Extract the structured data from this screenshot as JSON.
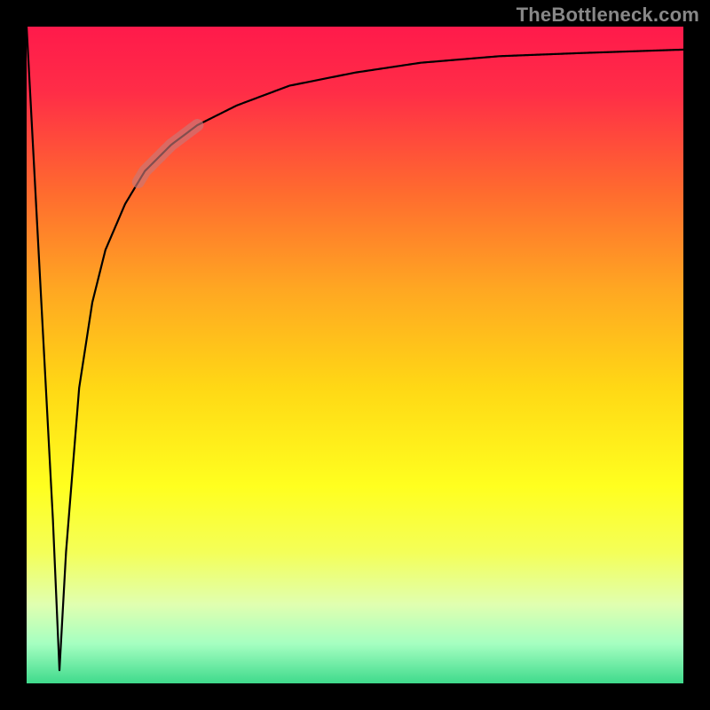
{
  "watermark": "TheBottleneck.com",
  "colors": {
    "frame": "#000000",
    "curve": "#000000",
    "highlight": "rgba(200,120,120,0.65)",
    "gradient_stops": [
      {
        "offset": 0.0,
        "color": "#ff1a4b"
      },
      {
        "offset": 0.1,
        "color": "#ff2d47"
      },
      {
        "offset": 0.25,
        "color": "#ff6a2f"
      },
      {
        "offset": 0.4,
        "color": "#ffa722"
      },
      {
        "offset": 0.55,
        "color": "#ffd815"
      },
      {
        "offset": 0.7,
        "color": "#ffff1f"
      },
      {
        "offset": 0.8,
        "color": "#f4ff58"
      },
      {
        "offset": 0.88,
        "color": "#e0ffb0"
      },
      {
        "offset": 0.94,
        "color": "#a5ffc1"
      },
      {
        "offset": 1.0,
        "color": "#3fda8c"
      }
    ]
  },
  "chart_data": {
    "type": "line",
    "title": "",
    "xlabel": "",
    "ylabel": "",
    "xlim": [
      0,
      100
    ],
    "ylim": [
      0,
      100
    ],
    "series": [
      {
        "name": "bottleneck-curve",
        "x": [
          0,
          4,
          5,
          6,
          8,
          10,
          12,
          15,
          18,
          22,
          26,
          32,
          40,
          50,
          60,
          72,
          85,
          100
        ],
        "y": [
          100,
          25,
          2,
          20,
          45,
          58,
          66,
          73,
          78,
          82,
          85,
          88,
          91,
          93,
          94.5,
          95.5,
          96,
          96.5
        ]
      }
    ],
    "highlight_segment": {
      "series": "bottleneck-curve",
      "x_start": 17,
      "x_end": 26
    },
    "annotations": []
  }
}
